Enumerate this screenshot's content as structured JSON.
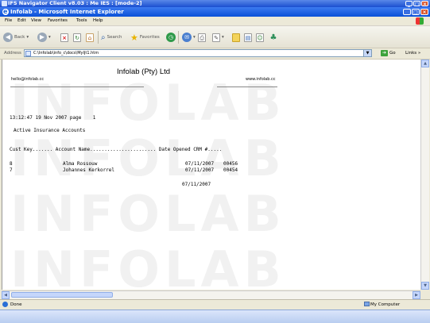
{
  "outer_window": {
    "title": "IFS Navigator Client v8.03 : Me IES : [mode-2]"
  },
  "browser": {
    "title": "Infolab - Microsoft Internet Explorer",
    "menu": [
      "File",
      "Edit",
      "View",
      "Favorites",
      "Tools",
      "Help"
    ],
    "toolbar": {
      "back": "Back",
      "search": "Search",
      "favorites": "Favorites"
    },
    "address": {
      "label": "Address",
      "value": "C:\\Infolab\\info_c\\docs\\MyIjt1.htm",
      "go": "Go",
      "links": "Links"
    },
    "status": {
      "text": "Done",
      "zone": "My Computer"
    }
  },
  "report": {
    "company": "Infolab (Pty) Ltd",
    "email": "hello@infolab.cc",
    "website": "www.infolab.cc",
    "date_line": "13:12:47 19 Nov 2007 page    1",
    "heading": "Active Insurance Accounts",
    "column_header": "Cust Key....... Account Name....................... Date Opened CRM #.....",
    "rows": [
      {
        "key": "8",
        "name": "Alma Rossouw",
        "date": "07/11/2007",
        "crm": "00456"
      },
      {
        "key": "7",
        "name": "Johannes Kerkorrel",
        "date": "07/11/2007",
        "crm": "00454"
      }
    ],
    "footer_date": "07/11/2007",
    "watermark": "INFOLAB"
  },
  "colors": {
    "titlebar": "#0a50d8",
    "close_button": "#d9542b",
    "go_button": "#3ca23c"
  }
}
